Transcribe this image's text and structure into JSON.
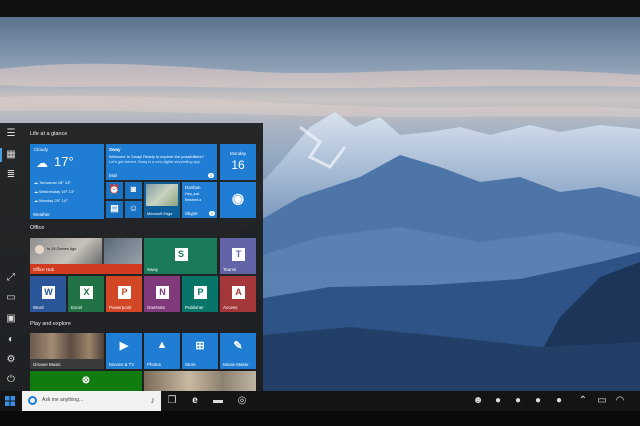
{
  "start_menu": {
    "group_life": "Life at a glance",
    "group_office": "Office",
    "group_play": "Play and explore",
    "weather": {
      "condition": "Cloudy",
      "temp": "17°",
      "forecast": [
        {
          "day": "Tomorrow",
          "hi": "18°",
          "lo": "13°"
        },
        {
          "day": "Wednesday",
          "hi": "19°",
          "lo": "13°"
        },
        {
          "day": "Monday",
          "hi": "20°",
          "lo": "14°"
        }
      ],
      "label": "Weather"
    },
    "mail": {
      "sender": "Sway",
      "line1": "Welcome to Sway! Ready to explore the possibilities?",
      "line2": "Let's get started. Sway is a new digital storytelling app.",
      "label": "Mail",
      "badge": "2"
    },
    "calendar": {
      "day": "Monday",
      "date": "16"
    },
    "edge_label": "Microsoft Edge",
    "skype": {
      "name": "Dashan",
      "line1": "Hey, just",
      "line2": "finished a",
      "label": "Skype",
      "badge": "9"
    },
    "office_hub": {
      "label": "Office Hub",
      "text": "In 15 Games Ago"
    },
    "apps": {
      "sway": "Sway",
      "teams": "Teams",
      "word": "Word",
      "excel": "Excel",
      "powerpoint": "Powerpoint",
      "onenote": "OneNote",
      "publisher": "Publisher",
      "access": "Access",
      "groove": "Groove Music",
      "movies": "Movies & TV",
      "photos": "Photos",
      "store": "Store",
      "moviemaker": "Movie Maker"
    }
  },
  "taskbar": {
    "search_placeholder": "Ask me anything..."
  },
  "colors": {
    "accent": "#1f7ed4",
    "office_red": "#d13c21",
    "teams": "#6264a7",
    "word": "#2b579a",
    "excel": "#217346",
    "powerpoint": "#d24726",
    "onenote": "#80397b",
    "publisher": "#077568",
    "access": "#a4373a",
    "xbox": "#107c10"
  }
}
